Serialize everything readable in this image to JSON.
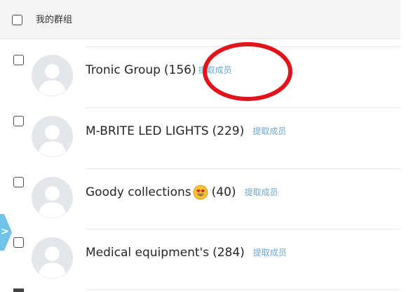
{
  "header": {
    "title": "我的群组"
  },
  "groups": [
    {
      "name": "Tronic Group",
      "count": "(156)",
      "action": "提取成员"
    },
    {
      "name": "M-BRITE LED LIGHTS",
      "count": "(229)",
      "action": "提取成员"
    },
    {
      "name": "Goody collections",
      "count": "(40)",
      "action": "提取成员",
      "emoji": "heart-eyes-emoji"
    },
    {
      "name": "Medical equipment's",
      "count": "(284)",
      "action": "提取成员"
    }
  ],
  "side_tab": {
    "label": ">",
    "color": "#6ec3ea"
  },
  "colors": {
    "link": "#6aa7d6",
    "annotation": "#e2141b",
    "header_bg": "#f4f4f4",
    "avatar_bg": "#e3e6ea"
  }
}
